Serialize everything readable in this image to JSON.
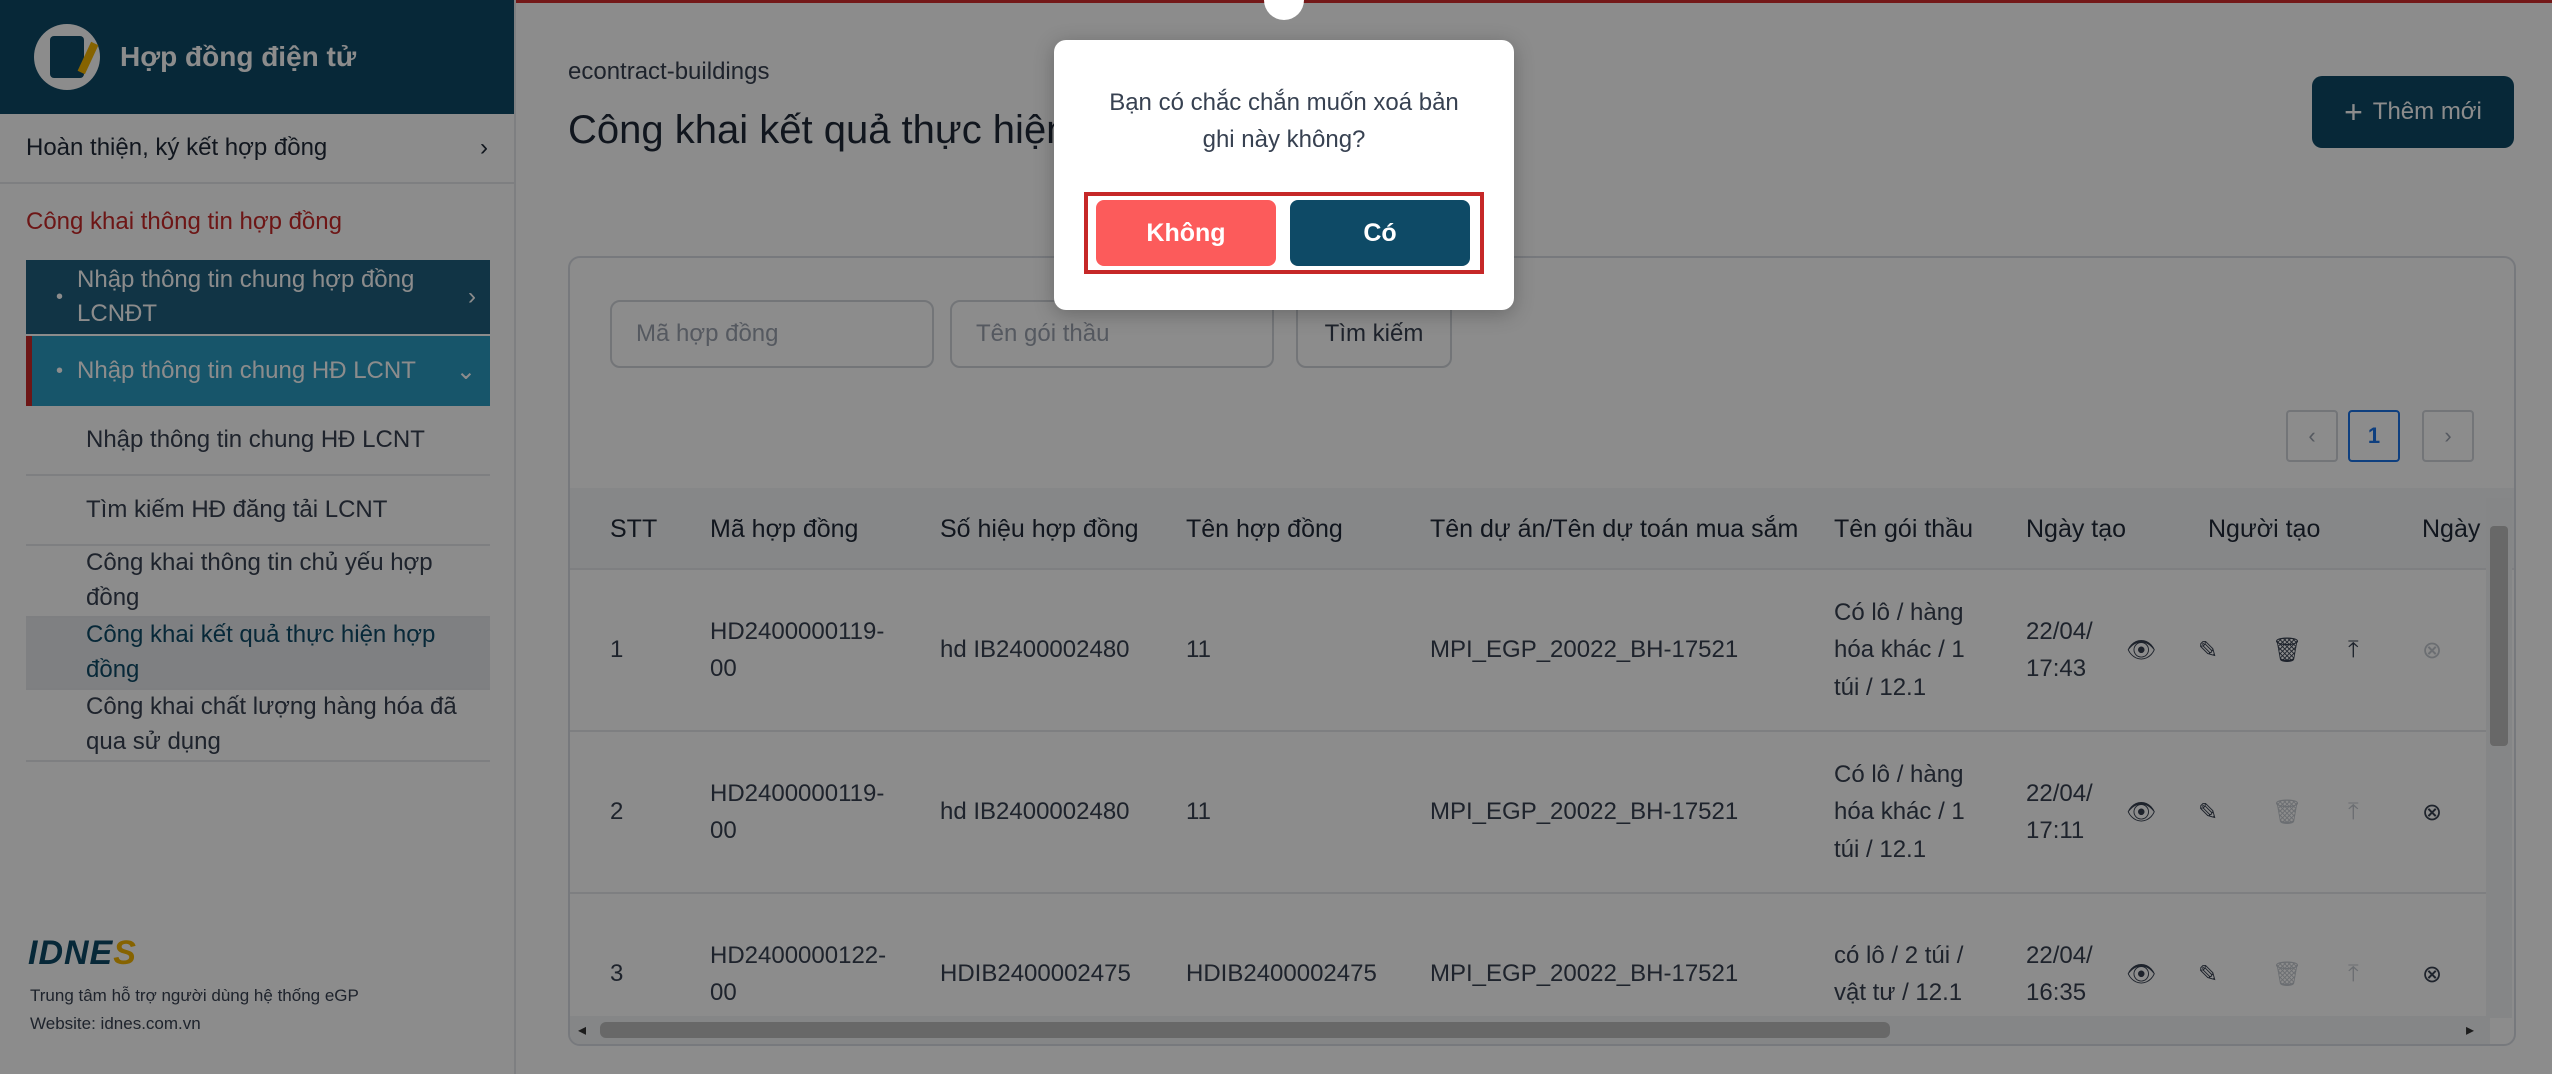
{
  "sidebar": {
    "app_title": "Hợp đồng điện tử",
    "item_finalize": "Hoàn thiện, ký kết hợp đồng",
    "section_title": "Công khai thông tin hợp đồng",
    "group_lcndt": "Nhập thông tin chung hợp đồng LCNĐT",
    "group_lcnt": "Nhập thông tin chung HĐ LCNT",
    "sub_items": [
      "Nhập thông tin chung HĐ LCNT",
      "Tìm kiếm HĐ đăng tải LCNT",
      "Công khai thông tin chủ yếu hợp đồng",
      "Công khai kết quả thực hiện hợp đồng",
      "Công khai chất lượng hàng hóa đã qua sử dụng"
    ],
    "footer_org": "Trung tâm hỗ trợ người dùng hệ thống eGP",
    "footer_site": "Website: idnes.com.vn"
  },
  "main": {
    "breadcrumb": "econtract-buildings",
    "title": "Công khai kết quả thực hiện hợp đồng",
    "add_button": "Thêm mới",
    "filter": {
      "contract_code_placeholder": "Mã hợp đồng",
      "package_name_placeholder": "Tên gói thầu",
      "search_button": "Tìm kiếm"
    },
    "pagination": {
      "prev": "‹",
      "current": "1",
      "next": "›"
    },
    "table": {
      "columns": [
        "STT",
        "Mã hợp đồng",
        "Số hiệu hợp đồng",
        "Tên hợp đồng",
        "Tên dự án/Tên dự toán mua sắm",
        "Tên gói thầu",
        "Ngày tạo",
        "Người tạo",
        "Ngày"
      ],
      "rows": [
        {
          "stt": "1",
          "code": "HD2400000119-00",
          "number": "hd IB2400002480",
          "name": "11",
          "project": "MPI_EGP_20022_BH-17521",
          "package": "Có lô / hàng hóa khác / 1 túi / 12.1",
          "date": "22/04/ 17:43",
          "creator": ""
        },
        {
          "stt": "2",
          "code": "HD2400000119-00",
          "number": "hd IB2400002480",
          "name": "11",
          "project": "MPI_EGP_20022_BH-17521",
          "package": "Có lô / hàng hóa khác / 1 túi / 12.1",
          "date": "22/04/ 17:11",
          "creator": ""
        },
        {
          "stt": "3",
          "code": "HD2400000122-00",
          "number": "HDIB2400002475",
          "name": "HDIB2400002475",
          "project": "MPI_EGP_20022_BH-17521",
          "package": "có lô / 2 túi / vật tư / 12.1",
          "date": "22/04/ 16:35",
          "creator": ""
        }
      ]
    }
  },
  "dialog": {
    "message": "Bạn có chắc chắn muốn xoá bản ghi này không?",
    "no_button": "Không",
    "yes_button": "Có"
  },
  "colors": {
    "primary": "#0e4a66",
    "accent_red": "#c62828",
    "cancel_red": "#fc5b5b",
    "active_blue": "#2a9bc1"
  }
}
